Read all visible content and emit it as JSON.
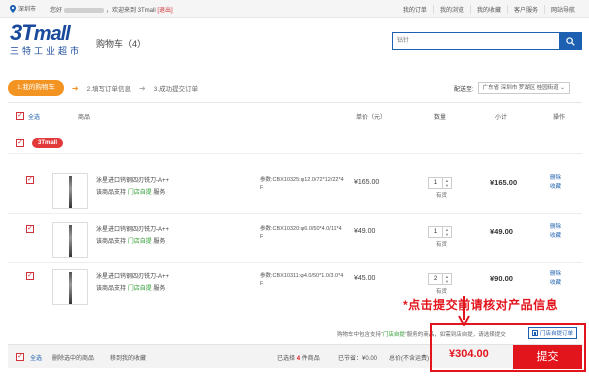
{
  "topbar": {
    "location": "深圳市",
    "greeting_prefix": "您好",
    "greeting_suffix": "，欢迎来到 3Tmall",
    "logout": "[退出]",
    "nav": [
      "我的订单",
      "我的浏览",
      "我的收藏",
      "客户服务",
      "网站导航"
    ]
  },
  "header": {
    "logo_main": "3T",
    "logo_mall": "mall",
    "logo_sub": "三特工业超市",
    "cart_title": "购物车（4）",
    "search_placeholder": "钻针"
  },
  "steps": {
    "step1": "1.我的购物车",
    "step2": "2.填写订单信息",
    "step3": "3.成功提交订单"
  },
  "shipping": {
    "label": "配送至:",
    "address": "广东省 深圳市 罗湖区 桂园街道"
  },
  "table_head": {
    "select_all": "全选",
    "product": "商品",
    "unit_price": "单价（元）",
    "quantity": "数量",
    "subtotal": "小计",
    "action": "操作"
  },
  "store": {
    "name": "3Tmall"
  },
  "items": [
    {
      "name": "泳星进口钨钢四刃铣刀-A++",
      "service_prefix": "该商品支持",
      "service_green": "门店自提",
      "service_suffix": "服务",
      "param": "参数:CBX10325:φ12.0/72*12/22*4F",
      "price": "¥165.00",
      "qty": "1",
      "stock": "有货",
      "subtotal": "¥165.00",
      "op1": "删除",
      "op2": "收藏"
    },
    {
      "name": "泳星进口钨钢四刃铣刀-A++",
      "service_prefix": "该商品支持",
      "service_green": "门店自提",
      "service_suffix": "服务",
      "param": "参数:CBX10320:φ6.0/50*4.0/11*4F",
      "price": "¥49.00",
      "qty": "1",
      "stock": "有货",
      "subtotal": "¥49.00",
      "op1": "删除",
      "op2": "收藏"
    },
    {
      "name": "泳星进口钨钢四刃铣刀-A++",
      "service_prefix": "该商品支持",
      "service_green": "门店自提",
      "service_suffix": "服务",
      "param": "参数:CBX10311:φ4.0/50*1.0/3.0*4F",
      "price": "¥45.00",
      "qty": "2",
      "stock": "有货",
      "subtotal": "¥90.00",
      "op1": "删除",
      "op2": "收藏"
    }
  ],
  "notice": "*点击提交前请核对产品信息",
  "hint": {
    "prefix": "购物车中包含支持“",
    "green": "门店自提",
    "middle": "”服务的商品，如需到店自提，请选择提交",
    "button": "门店自提订单"
  },
  "footer": {
    "select_all": "全选",
    "delete_selected": "删除选中的商品",
    "move_to_fav": "移到我的收藏",
    "selected_prefix": "已选择",
    "selected_count": "4",
    "selected_suffix": "件商品",
    "saved": "已节省：¥0.00",
    "total_label": "总价(不含运费)：",
    "total": "¥304.00",
    "submit": "提交"
  },
  "colors": {
    "accent_red": "#e2141c",
    "brand_blue": "#1d5fb0",
    "step_orange": "#f29322",
    "service_green": "#2e9b2e"
  }
}
